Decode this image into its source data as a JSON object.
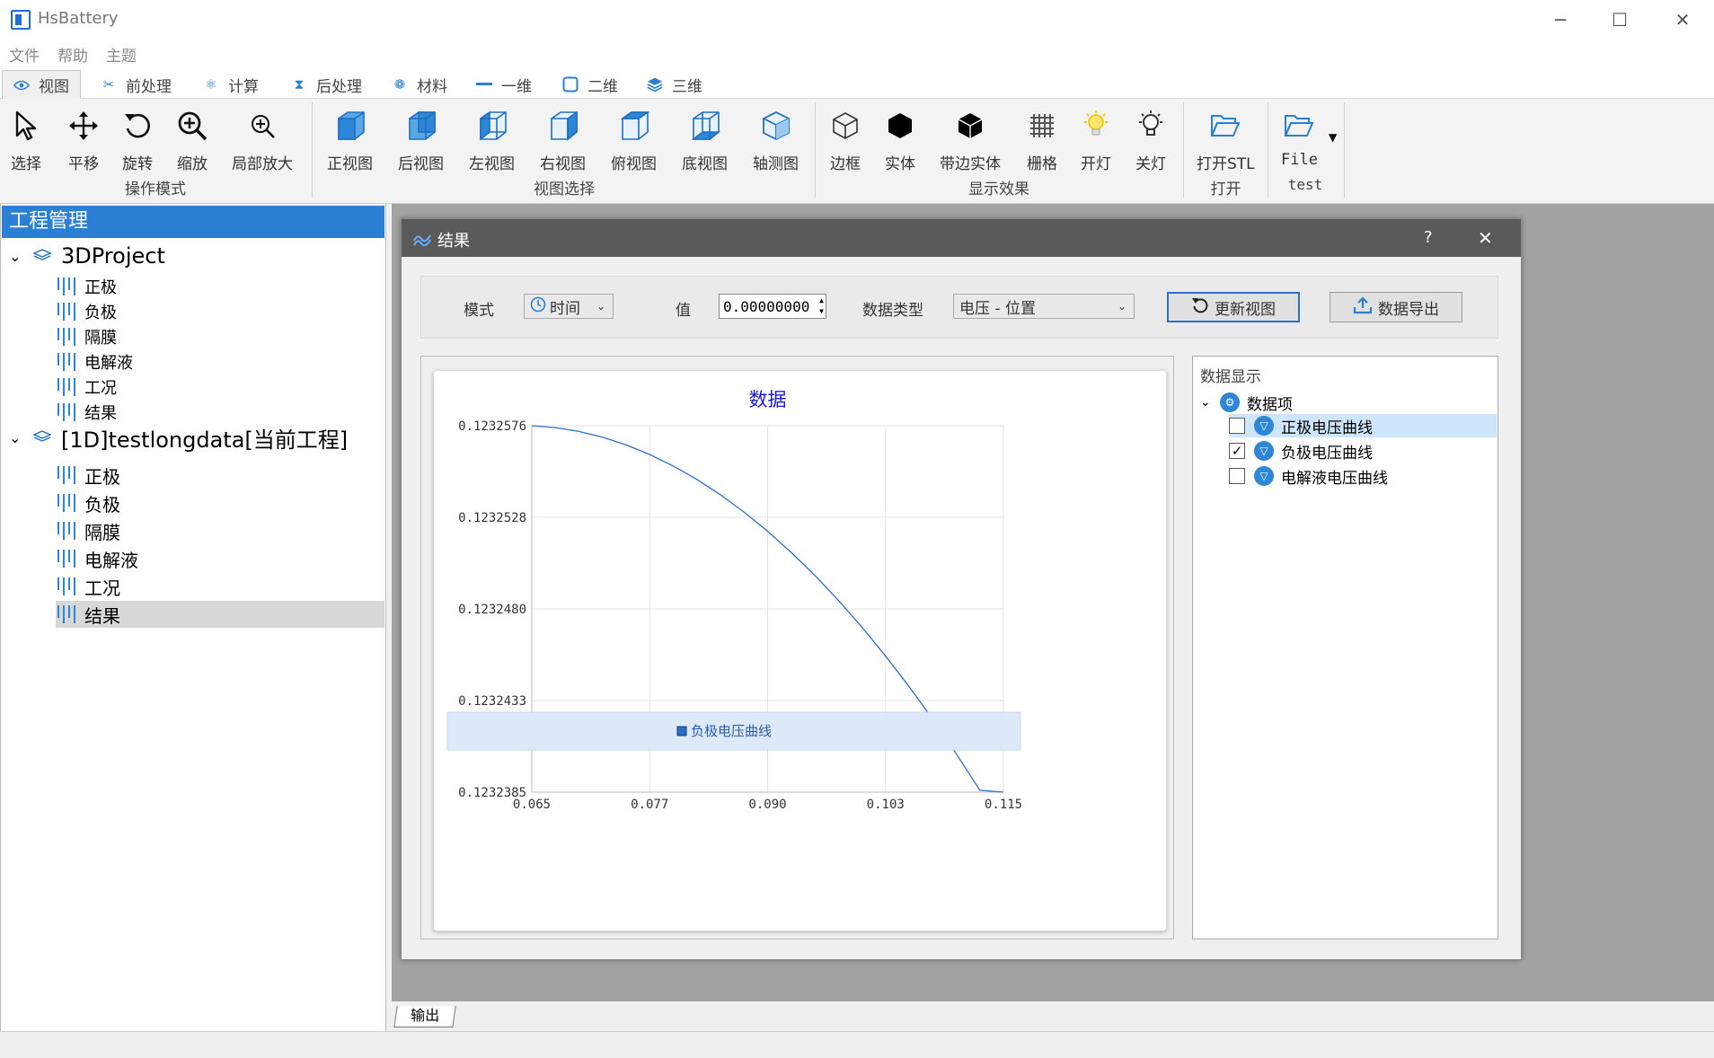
{
  "window": {
    "title": "HsBattery",
    "minimize": "─",
    "maximize": "☐",
    "close": "✕"
  },
  "menu": [
    "文件",
    "帮助",
    "主题"
  ],
  "tabs": [
    {
      "label": "视图",
      "icon": "eye-icon",
      "active": true
    },
    {
      "label": "前处理",
      "icon": "scissors-icon"
    },
    {
      "label": "计算",
      "icon": "atom-icon"
    },
    {
      "label": "后处理",
      "icon": "hourglass-icon"
    },
    {
      "label": "材料",
      "icon": "molecule-icon"
    },
    {
      "label": "一维",
      "icon": "line-icon"
    },
    {
      "label": "二维",
      "icon": "square-icon"
    },
    {
      "label": "三维",
      "icon": "layers-icon"
    }
  ],
  "ribbon": {
    "operation": {
      "label": "操作模式",
      "buttons": [
        "选择",
        "平移",
        "旋转",
        "缩放",
        "局部放大"
      ]
    },
    "views": {
      "label": "视图选择",
      "buttons": [
        "正视图",
        "后视图",
        "左视图",
        "右视图",
        "俯视图",
        "底视图",
        "轴测图"
      ]
    },
    "display": {
      "label": "显示效果",
      "buttons": [
        "边框",
        "实体",
        "带边实体",
        "栅格",
        "开灯",
        "关灯"
      ]
    },
    "open": {
      "label": "打开",
      "buttons": [
        "打开STL"
      ]
    },
    "test": {
      "label": "test",
      "buttons": [
        "File"
      ]
    }
  },
  "project": {
    "header": "工程管理",
    "roots": [
      {
        "label": "3DProject",
        "children": [
          "正极",
          "负极",
          "隔膜",
          "电解液",
          "工况",
          "结果"
        ]
      },
      {
        "label": "[1D]testlongdata[当前工程]",
        "children": [
          "正极",
          "负极",
          "隔膜",
          "电解液",
          "工况",
          "结果"
        ]
      }
    ]
  },
  "dialog": {
    "title": "结果",
    "help": "?",
    "close": "✕",
    "controls": {
      "mode_label": "模式",
      "mode_value": "时间",
      "value_label": "值",
      "value": "0.00000000",
      "datatype_label": "数据类型",
      "datatype_value": "电压 - 位置",
      "refresh": "更新视图",
      "export": "数据导出"
    },
    "data_display": {
      "title": "数据显示",
      "root": "数据项",
      "items": [
        {
          "label": "正极电压曲线",
          "checked": false,
          "highlight": true
        },
        {
          "label": "负极电压曲线",
          "checked": true,
          "highlight": false
        },
        {
          "label": "电解液电压曲线",
          "checked": false,
          "highlight": false
        }
      ]
    }
  },
  "chart_data": {
    "type": "line",
    "title": "数据",
    "xlim": [
      0.065,
      0.115
    ],
    "ylim": [
      0.1232385,
      0.1232576
    ],
    "xticks": [
      "0.065",
      "0.077",
      "0.090",
      "0.103",
      "0.115"
    ],
    "yticks": [
      "0.1232576",
      "0.1232528",
      "0.1232480",
      "0.1232433",
      "0.1232385"
    ],
    "grid": true,
    "legend": "bottom",
    "series": [
      {
        "name": "负极电压曲线",
        "color": "#2a6fc9",
        "x": [
          0.065,
          0.0675,
          0.07,
          0.0725,
          0.075,
          0.0775,
          0.08,
          0.0825,
          0.085,
          0.0875,
          0.09,
          0.0925,
          0.095,
          0.0975,
          0.1,
          0.1025,
          0.105,
          0.1075,
          0.11,
          0.1125,
          0.115
        ],
        "y": [
          0.1232576,
          0.1232575,
          0.1232573,
          0.123257,
          0.1232566,
          0.1232561,
          0.1232555,
          0.1232548,
          0.123254,
          0.1232531,
          0.1232521,
          0.123251,
          0.1232498,
          0.1232485,
          0.1232471,
          0.1232456,
          0.123244,
          0.1232423,
          0.1232405,
          0.1232386,
          0.1232385
        ]
      }
    ]
  }
}
